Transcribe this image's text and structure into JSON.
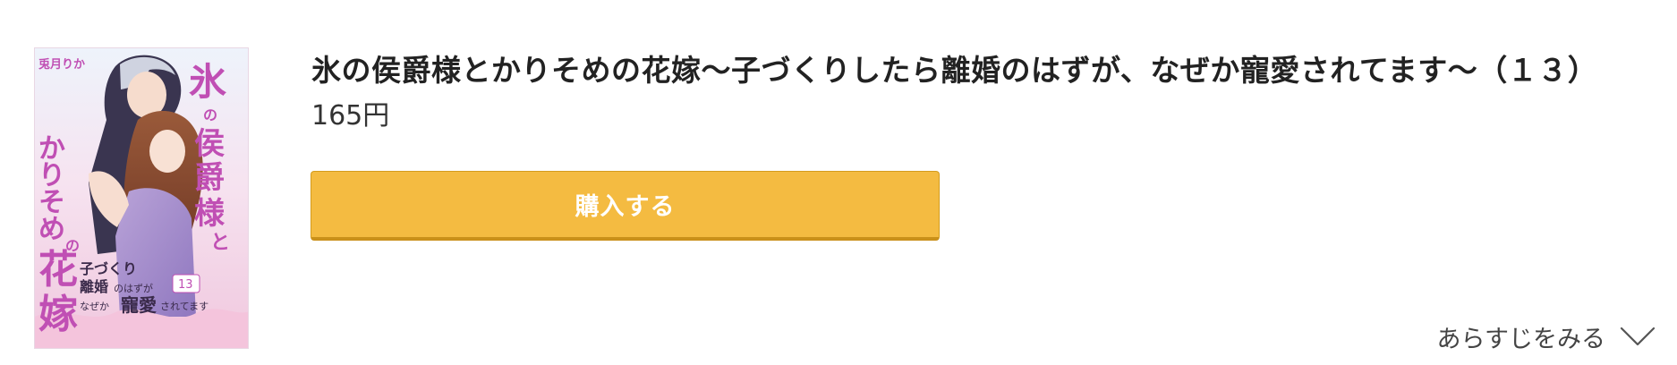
{
  "product": {
    "title": "氷の侯爵様とかりそめの花嫁〜子づくりしたら離婚のはずが、なぜか寵愛されてます〜（１３）",
    "price": "165円"
  },
  "cover": {
    "title_text": "氷の侯爵様とかりそめの花嫁",
    "subtitle_text": "子づくりしたら離婚のはずが、なぜか寵愛されてます",
    "author": "兎月りか",
    "volume": "13"
  },
  "actions": {
    "buy_label": "購入する",
    "synopsis_label": "あらすじをみる",
    "synopsis_icon": "chevron-down-icon"
  },
  "colors": {
    "buy_button": "#f4bb41",
    "buy_button_shadow": "#c9901a",
    "cover_accent": "#c04fb4"
  }
}
